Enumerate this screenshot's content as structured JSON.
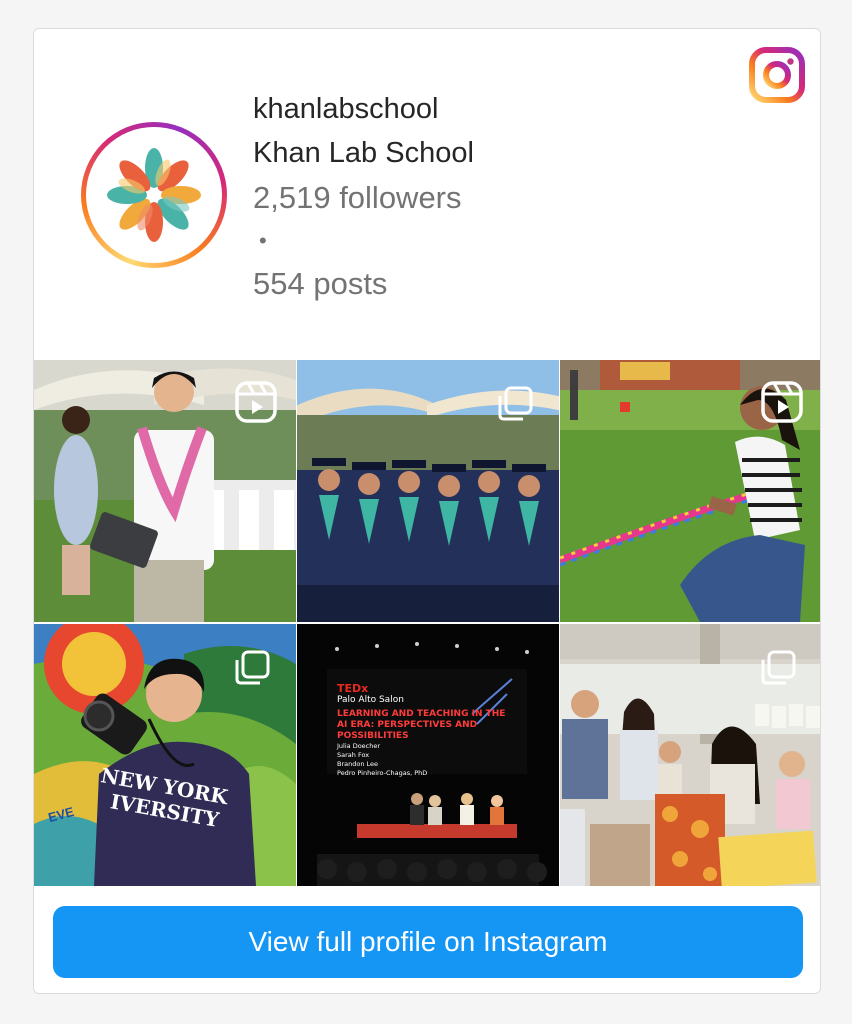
{
  "profile": {
    "username": "khanlabschool",
    "full_name": "Khan Lab School",
    "followers": "2,519 followers",
    "separator": "•",
    "posts": "554 posts",
    "avatar_icon": "flower-logo-icon"
  },
  "brand_icon": "instagram-icon",
  "grid": {
    "tiles": [
      {
        "kind": "reel",
        "badge_icon": "reel-icon"
      },
      {
        "kind": "carousel",
        "badge_icon": "carousel-icon"
      },
      {
        "kind": "reel",
        "badge_icon": "reel-icon"
      },
      {
        "kind": "carousel",
        "badge_icon": "carousel-icon",
        "hoodie_line1": "NEW YORK",
        "hoodie_line2": "IVERSITY",
        "mural_text": "EVE"
      },
      {
        "kind": "post",
        "ted_brand": "TEDx",
        "ted_salon": "Palo Alto Salon",
        "ted_title": "LEARNING AND TEACHING IN THE AI ERA: PERSPECTIVES AND POSSIBILITIES",
        "ted_speakers": [
          "Julia Doecher",
          "Sarah Fox",
          "Brandon Lee",
          "Pedro Pinheiro-Chagas, PhD"
        ]
      },
      {
        "kind": "carousel",
        "badge_icon": "carousel-icon"
      }
    ]
  },
  "cta": {
    "label": "View full profile on Instagram"
  },
  "colors": {
    "cta_background": "#1596f4",
    "secondary_text": "#737373",
    "primary_text": "#262626"
  }
}
